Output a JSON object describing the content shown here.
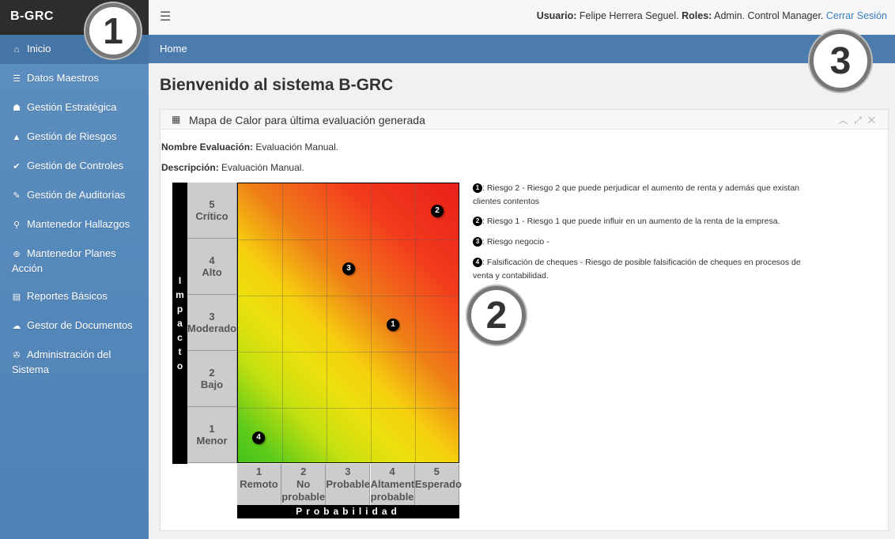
{
  "brand": {
    "name": "B-GRC"
  },
  "callouts": {
    "one": "1",
    "two": "2",
    "three": "3"
  },
  "sidebar": {
    "items": [
      {
        "label": "Inicio",
        "icon": "home-icon",
        "glyph": "⌂"
      },
      {
        "label": "Datos Maestros",
        "icon": "list-icon",
        "glyph": "☰"
      },
      {
        "label": "Gestión Estratégica",
        "icon": "sitemap-icon",
        "glyph": "☗"
      },
      {
        "label": "Gestión de Riesgos",
        "icon": "warning-icon",
        "glyph": "▲"
      },
      {
        "label": "Gestión de Controles",
        "icon": "check-circle-icon",
        "glyph": "✔"
      },
      {
        "label": "Gestión de Auditorías",
        "icon": "edit-icon",
        "glyph": "✎"
      },
      {
        "label": "Mantenedor Hallazgos",
        "icon": "search-icon",
        "glyph": "⚲"
      },
      {
        "label": "Mantenedor Planes Acción",
        "icon": "plus-circle-icon",
        "glyph": "⊕"
      },
      {
        "label": "Reportes Básicos",
        "icon": "bar-chart-icon",
        "glyph": "▤"
      },
      {
        "label": "Gestor de Documentos",
        "icon": "cloud-icon",
        "glyph": "☁"
      },
      {
        "label": "Administración del Sistema",
        "icon": "wrench-icon",
        "glyph": "✇"
      }
    ]
  },
  "topbar": {
    "menu_icon": "hamburger-icon",
    "user_label": "Usuario:",
    "user_name": "Felipe Herrera Seguel.",
    "roles_label": "Roles:",
    "roles": "Admin. Control Manager.",
    "logout": "Cerrar Sesión"
  },
  "breadcrumb": {
    "home": "Home"
  },
  "page": {
    "title": "Bienvenido al sistema B-GRC"
  },
  "panel": {
    "title": "Mapa de Calor para última evaluación generada",
    "controls": [
      "chevron-up-icon",
      "expand-icon",
      "close-icon"
    ],
    "eval_label": "Nombre Evaluación:",
    "eval_value": "Evaluación Manual.",
    "desc_label": "Descripción:",
    "desc_value": "Evaluación Manual."
  },
  "heatmap": {
    "impact_axis": "Impacto",
    "prob_axis": "Probabilidad",
    "impact_levels": [
      {
        "num": "5",
        "name": "Crítico"
      },
      {
        "num": "4",
        "name": "Alto"
      },
      {
        "num": "3",
        "name": "Moderado"
      },
      {
        "num": "2",
        "name": "Bajo"
      },
      {
        "num": "1",
        "name": "Menor"
      }
    ],
    "prob_levels": [
      {
        "num": "1",
        "name": "Remoto"
      },
      {
        "num": "2",
        "name": "No probable"
      },
      {
        "num": "3",
        "name": "Probable"
      },
      {
        "num": "4",
        "name": "Altamente probable"
      },
      {
        "num": "5",
        "name": "Esperado"
      }
    ],
    "markers": [
      {
        "id": "1",
        "impact": 3,
        "prob": 4
      },
      {
        "id": "2",
        "impact": 5,
        "prob": 5
      },
      {
        "id": "3",
        "impact": 4,
        "prob": 3
      },
      {
        "id": "4",
        "impact": 1,
        "prob": 1
      }
    ]
  },
  "legend": [
    {
      "id": "1",
      "text": ": Riesgo 2 - Riesgo 2 que puede perjudicar el aumento de renta y además que existan clientes contentos"
    },
    {
      "id": "2",
      "text": ": Riesgo 1 - Riesgo 1 que puede influir en un aumento de la renta de la empresa."
    },
    {
      "id": "3",
      "text": ": Riesgo negocio -"
    },
    {
      "id": "4",
      "text": ": Falsificación de cheques - Riesgo de posible falsificación de cheques en procesos de venta y contabilidad."
    }
  ]
}
